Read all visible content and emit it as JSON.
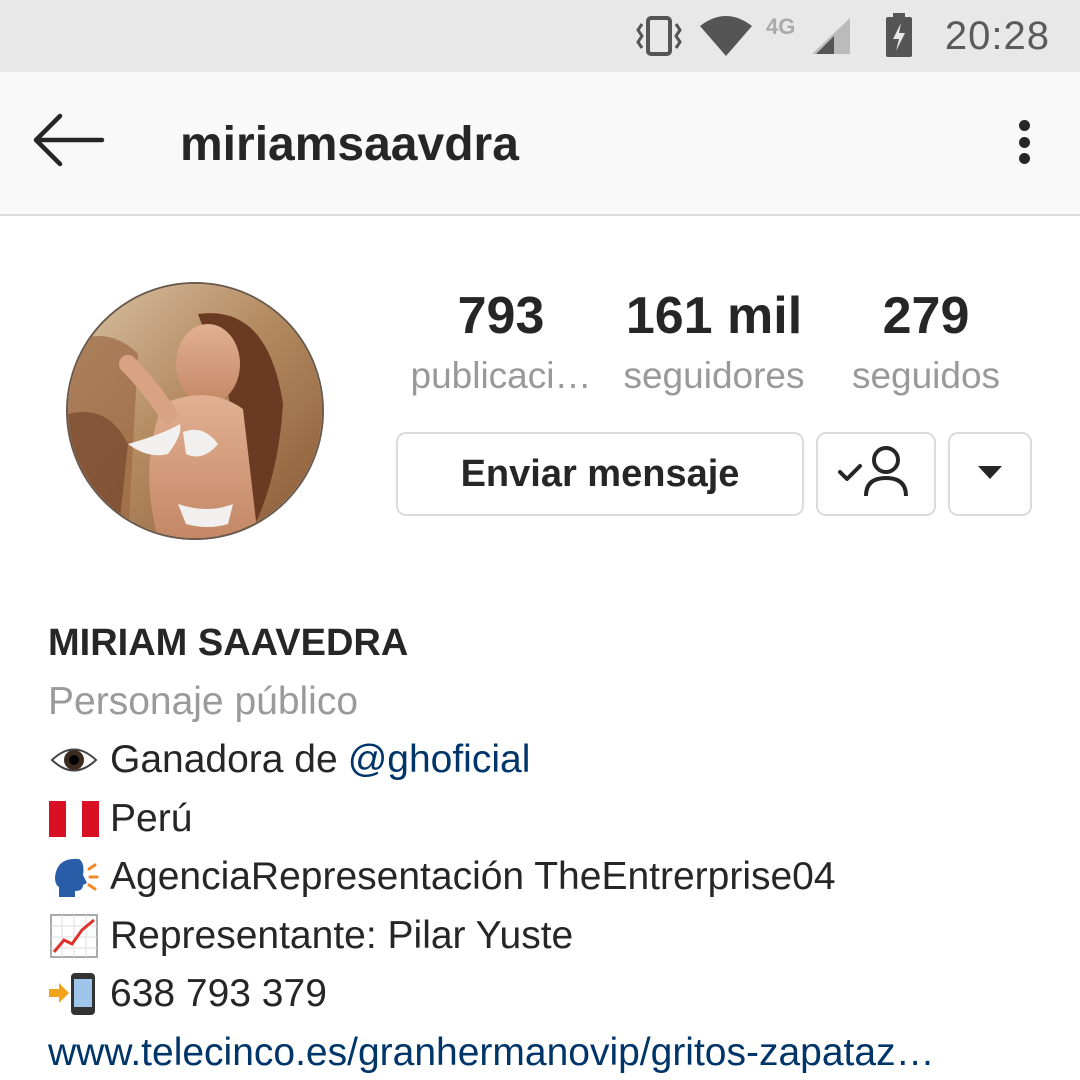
{
  "status_bar": {
    "time": "20:28",
    "network": "4G",
    "icons": [
      "vibrate-icon",
      "wifi-icon",
      "signal-icon",
      "battery-charging-icon"
    ]
  },
  "header": {
    "username": "miriamsaavdra",
    "back_icon": "back-arrow-icon",
    "more_icon": "more-vertical-icon"
  },
  "profile": {
    "stats": [
      {
        "value": "793",
        "label": "publicaci…"
      },
      {
        "value": "161 mil",
        "label": "seguidores"
      },
      {
        "value": "279",
        "label": "seguidos"
      }
    ],
    "buttons": {
      "message_label": "Enviar mensaje",
      "following_icon": "following-user-icon",
      "dropdown_icon": "dropdown-triangle-icon"
    }
  },
  "bio": {
    "name": "MIRIAM SAAVEDRA",
    "category": "Personaje público",
    "line1_text": "Ganadora de",
    "line1_mention": "@ghoficial",
    "line2_text": "Perú",
    "line3_text": "AgenciaRepresentación TheEntrerprise04",
    "line4_text": "Representante: Pilar Yuste",
    "line5_text": "638 793 379",
    "website": "www.telecinco.es/granhermanovip/gritos-zapataz…",
    "emoji_icons": [
      "eye-emoji-icon",
      "peru-flag-icon",
      "speaking-head-icon",
      "chart-increasing-icon",
      "mobile-arrow-icon"
    ]
  },
  "colors": {
    "link": "#003569",
    "muted": "#999999",
    "border": "#dbdbdb",
    "status_bar_bg": "#e8e8e8"
  }
}
